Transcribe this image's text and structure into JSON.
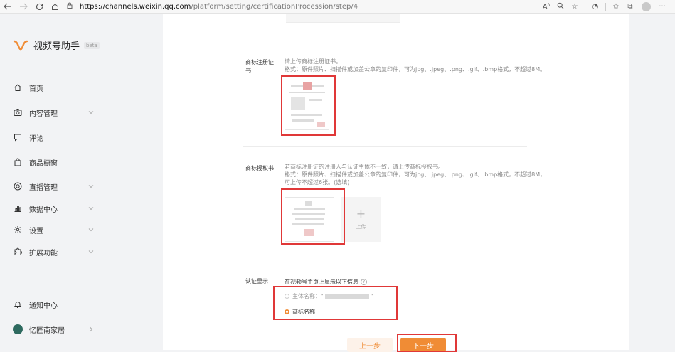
{
  "browser": {
    "url_host": "https://channels.weixin.qq.com",
    "url_path": "/platform/setting/certificationProcession/step/4"
  },
  "sidebar": {
    "app_name": "视频号助手",
    "badge": "beta",
    "items": [
      {
        "label": "首页",
        "icon": "home-icon"
      },
      {
        "label": "内容管理",
        "icon": "camera-icon"
      },
      {
        "label": "评论",
        "icon": "comment-icon"
      },
      {
        "label": "商品橱窗",
        "icon": "bag-icon"
      },
      {
        "label": "直播管理",
        "icon": "live-icon"
      },
      {
        "label": "数据中心",
        "icon": "chart-icon"
      },
      {
        "label": "设置",
        "icon": "gear-icon"
      },
      {
        "label": "扩展功能",
        "icon": "puzzle-icon"
      }
    ],
    "notification_label": "通知中心",
    "account_name": "忆匠南家居"
  },
  "form": {
    "trademark_cert": {
      "label": "商标注册证书",
      "desc_line1": "请上传商标注册证书。",
      "desc_line2": "格式：原件照片、扫描件或加盖公章的复印件，可为jpg、.jpeg、.png、.gif、.bmp格式，不超过8M。"
    },
    "trademark_auth": {
      "label": "商标授权书",
      "desc_line1": "若商标注册证的注册人与认证主体不一致，请上传商标授权书。",
      "desc_line2": "格式：原件照片、扫描件或加盖公章的复印件，可为jpg、.jpeg、.png、.gif、.bmp格式，不超过8M，可上传不超过6张。(选填)",
      "upload_label": "上传"
    },
    "display": {
      "label": "认证显示",
      "heading": "在视频号主页上显示以下信息",
      "option_subject_prefix": "主体名称：\"",
      "option_subject_suffix": "\"",
      "option_trademark": "商标名称",
      "selected": "商标名称"
    },
    "prev_button": "上一步",
    "next_button": "下一步"
  },
  "colors": {
    "accent": "#f08c35",
    "highlight": "#e03838"
  }
}
